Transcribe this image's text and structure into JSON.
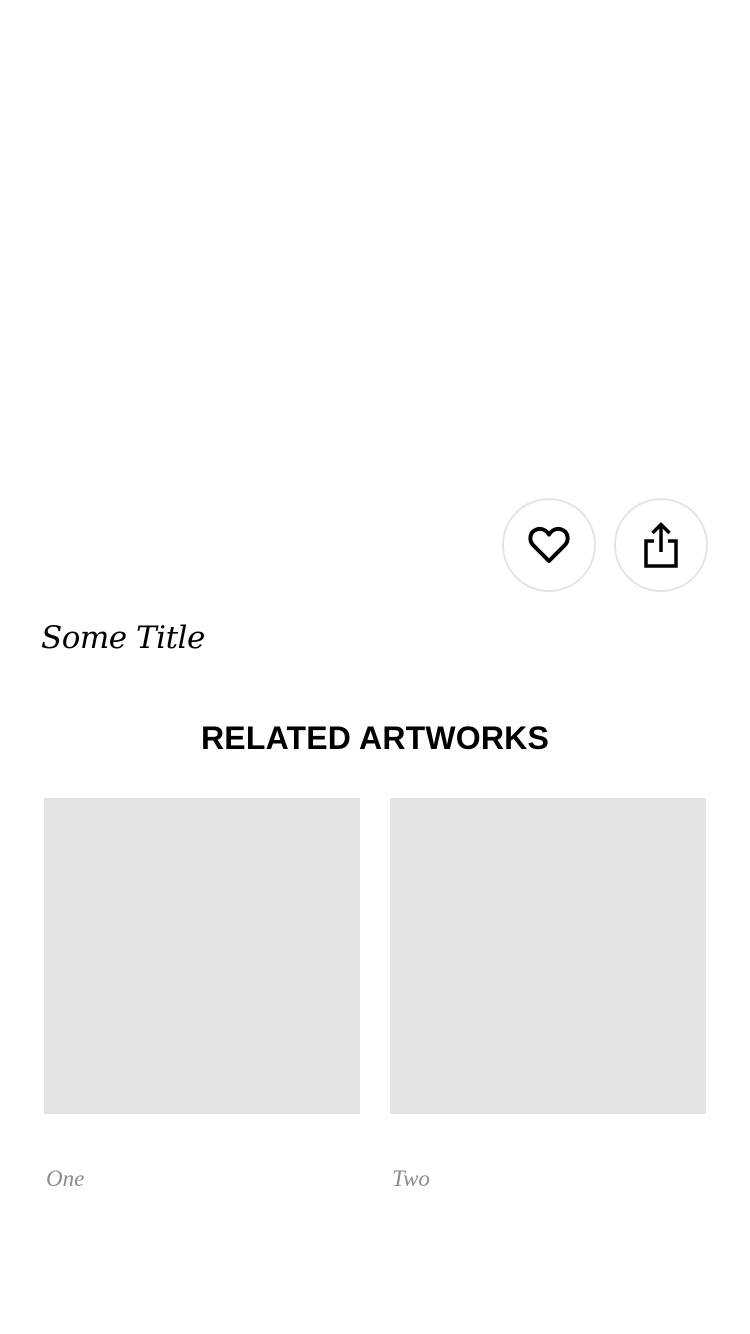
{
  "artwork": {
    "title": "Some Title"
  },
  "actions": {
    "favorite_icon": "heart-icon",
    "share_icon": "share-icon"
  },
  "related": {
    "heading": "RELATED ARTWORKS",
    "items": [
      {
        "caption": "One"
      },
      {
        "caption": "Two"
      }
    ]
  },
  "colors": {
    "placeholder": "#e4e4e4",
    "button_border": "#e4e4e4",
    "caption": "#8c8c8c",
    "text": "#000000"
  }
}
